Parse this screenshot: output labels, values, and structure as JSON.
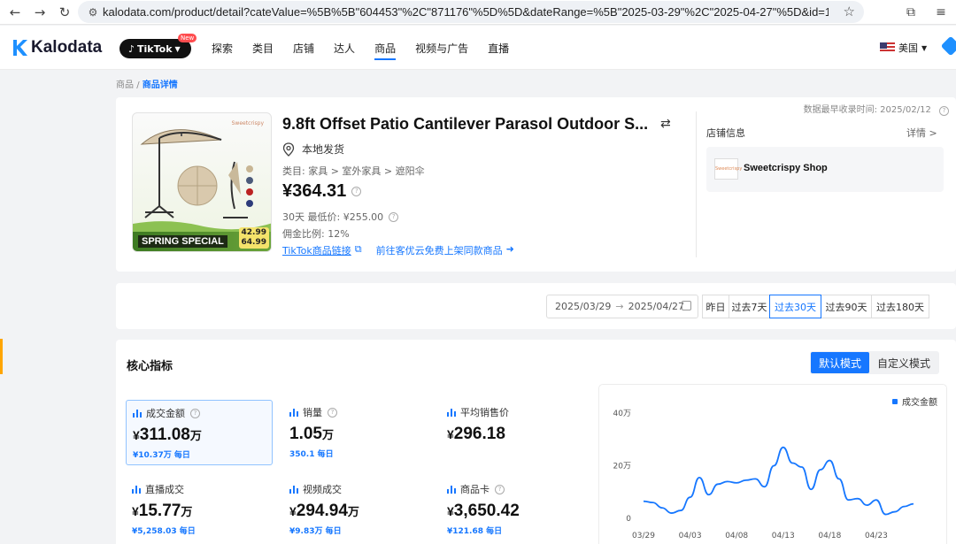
{
  "browser": {
    "url": "kalodata.com/product/detail?cateValue=%5B%5B\"604453\"%2C\"871176\"%5D%5D&dateRange=%5B\"2025-03-29\"%2C\"2025-04-27\"%5D&id=17304142..."
  },
  "header": {
    "logo": "Kalodata",
    "tiktok_label": "TikTok",
    "new_badge": "New",
    "nav": [
      "探索",
      "类目",
      "店铺",
      "达人",
      "商品",
      "视频与广告",
      "直播"
    ],
    "active_nav": "商品",
    "language": "美国"
  },
  "breadcrumb": {
    "parent": "商品",
    "separator": "/",
    "current": "商品详情"
  },
  "product": {
    "title": "9.8ft Offset Patio Cantilever Parasol Outdoor S...",
    "shipping": "本地发货",
    "category": "类目: 家具 > 室外家具 > 遮阳伞",
    "price": "¥364.31",
    "low_price": "30天 最低价: ¥255.00",
    "commission": "佣金比例: 12%",
    "link_tiktok": "TikTok商品链接",
    "link_copy": "前往客优云免费上架同款商品",
    "image_banner": "SPRING SPECIAL",
    "image_price_1": "42.99",
    "image_price_2": "64.99",
    "image_brand": "Sweetcrispy"
  },
  "shop": {
    "record_time": "数据最早收录时间: 2025/02/12",
    "label": "店铺信息",
    "detail": "详情 >",
    "name": "Sweetcrispy Shop"
  },
  "date_filter": {
    "start": "2025/03/29",
    "arrow": "→",
    "end": "2025/04/27",
    "periods": [
      "昨日",
      "过去7天",
      "过去30天",
      "过去90天",
      "过去180天"
    ],
    "active_period": "过去30天"
  },
  "metrics_section": {
    "title": "核心指标",
    "modes": [
      "默认模式",
      "自定义模式"
    ],
    "active_mode": "默认模式",
    "items": [
      {
        "label": "成交金额",
        "currency": "¥",
        "value": "311.08",
        "unit": "万",
        "sub": "¥10.37万 每日",
        "has_info": true
      },
      {
        "label": "销量",
        "currency": "",
        "value": "1.05",
        "unit": "万",
        "sub": "350.1 每日",
        "has_info": true
      },
      {
        "label": "平均销售价",
        "currency": "¥",
        "value": "296.18",
        "unit": "",
        "sub": "",
        "has_info": false
      },
      {
        "label": "直播成交",
        "currency": "¥",
        "value": "15.77",
        "unit": "万",
        "sub": "¥5,258.03 每日",
        "has_info": false
      },
      {
        "label": "视频成交",
        "currency": "¥",
        "value": "294.94",
        "unit": "万",
        "sub": "¥9.83万 每日",
        "has_info": false
      },
      {
        "label": "商品卡",
        "currency": "¥",
        "value": "3,650.42",
        "unit": "",
        "sub": "¥121.68 每日",
        "has_info": true
      }
    ]
  },
  "chart_data": {
    "type": "line",
    "title": "",
    "legend": [
      "成交金额"
    ],
    "legend_position": "top-right",
    "series_color": "#1677ff",
    "y_ticks": [
      "0",
      "20万",
      "40万"
    ],
    "ylim": [
      0,
      40
    ],
    "y_unit": "万",
    "x_ticks": [
      "03/29",
      "04/03",
      "04/08",
      "04/13",
      "04/18",
      "04/23"
    ],
    "x": [
      "03/29",
      "03/30",
      "03/31",
      "04/01",
      "04/02",
      "04/03",
      "04/04",
      "04/05",
      "04/06",
      "04/07",
      "04/08",
      "04/09",
      "04/10",
      "04/11",
      "04/12",
      "04/13",
      "04/14",
      "04/15",
      "04/16",
      "04/17",
      "04/18",
      "04/19",
      "04/20",
      "04/21",
      "04/22",
      "04/23",
      "04/24",
      "04/25",
      "04/26",
      "04/27"
    ],
    "values": [
      6.5,
      6,
      4,
      2,
      3,
      8,
      15.5,
      9,
      13,
      14,
      13.5,
      14.5,
      15,
      12,
      20,
      27,
      21,
      19.5,
      11,
      18.5,
      22,
      15,
      7,
      7.5,
      5,
      7,
      1.5,
      2.5,
      4.5,
      5.5
    ],
    "grid": false
  }
}
